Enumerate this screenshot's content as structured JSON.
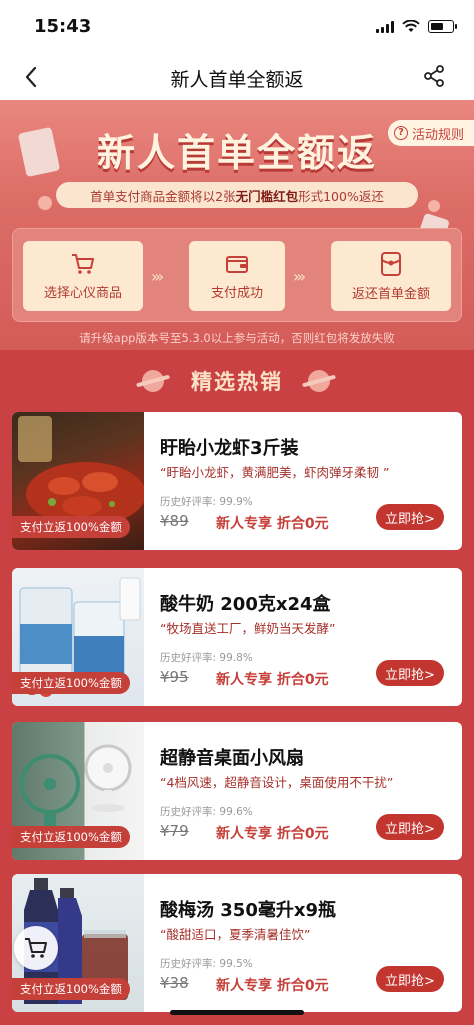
{
  "status_bar": {
    "time": "15:43"
  },
  "nav": {
    "title": "新人首单全额返",
    "back_icon": "back-arrow-icon",
    "share_icon": "share-icon"
  },
  "hero": {
    "title": "新人首单全额返",
    "rules_label": "活动规则",
    "subtitle_pre": "首单支付商品金额将以2张",
    "subtitle_bold": "无门槛红包",
    "subtitle_post": "形式100%返还"
  },
  "steps": [
    {
      "label": "选择心仪商品",
      "icon": "cart-icon"
    },
    {
      "label": "支付成功",
      "icon": "wallet-icon"
    },
    {
      "label": "返还首单金额",
      "icon": "red-packet-icon"
    }
  ],
  "notice": "请升级app版本号至5.3.0以上参与活动，否则红包将发放失败",
  "section_title": "精选热销",
  "products": [
    {
      "name": "盱眙小龙虾3斤装",
      "desc": "“盱眙小龙虾，黄满肥美，虾肉弹牙柔韧 ”",
      "rating_label": "历史好评率:",
      "rating": "99.9%",
      "price": "¥89",
      "deal": "新人专享 折合0元",
      "badge": "支付立返100%金额",
      "button": "立即抢>"
    },
    {
      "name": "酸牛奶 200克x24盒",
      "desc": "“牧场直送工厂，鲜奶当天发酵”",
      "rating_label": "历史好评率:",
      "rating": "99.8%",
      "price": "¥95",
      "deal": "新人专享 折合0元",
      "badge": "支付立返100%金额",
      "button": "立即抢>"
    },
    {
      "name": "超静音桌面小风扇",
      "desc": "“4档风速，超静音设计，桌面使用不干扰”",
      "rating_label": "历史好评率:",
      "rating": "99.6%",
      "price": "¥79",
      "deal": "新人专享 折合0元",
      "badge": "支付立返100%金额",
      "button": "立即抢>"
    },
    {
      "name": "酸梅汤 350毫升x9瓶",
      "desc": "“酸甜适口，夏季清暑佳饮”",
      "rating_label": "历史好评率:",
      "rating": "99.5%",
      "price": "¥38",
      "deal": "新人专享 折合0元",
      "badge": "支付立返100%金额",
      "button": "立即抢>"
    }
  ],
  "colors": {
    "brand_red": "#c94143",
    "cream": "#fde9cf",
    "button_red": "#c2362f"
  }
}
